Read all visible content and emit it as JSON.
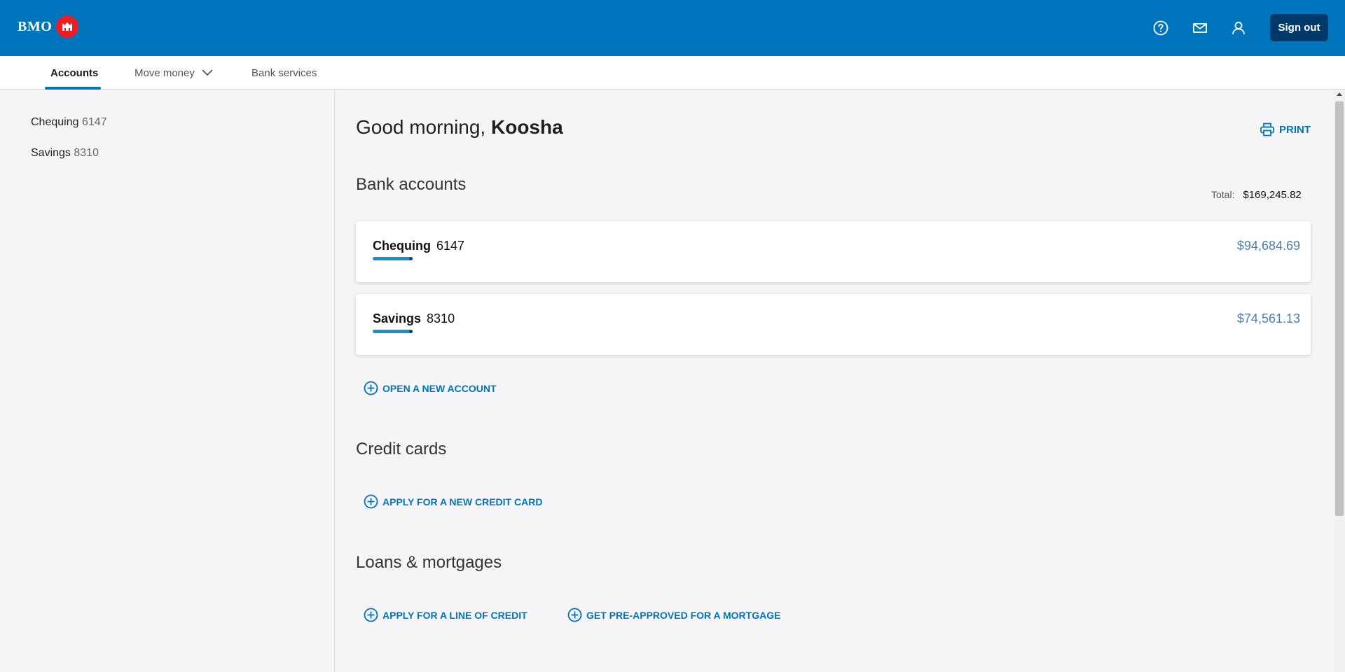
{
  "header": {
    "logo_text": "BMO",
    "signout_label": "Sign out",
    "icons": [
      "help-icon",
      "mail-icon",
      "profile-icon"
    ]
  },
  "nav": {
    "tabs": [
      {
        "label": "Accounts",
        "active": true
      },
      {
        "label": "Move money",
        "has_dropdown": true
      },
      {
        "label": "Bank services"
      }
    ]
  },
  "sidebar": {
    "items": [
      {
        "name": "Chequing",
        "number": "6147"
      },
      {
        "name": "Savings",
        "number": "8310"
      }
    ]
  },
  "main": {
    "greeting_prefix": "Good morning,",
    "user_name": "Koosha",
    "print_label": "PRINT",
    "bank_accounts": {
      "title": "Bank accounts",
      "total_label": "Total:",
      "total_value": "$169,245.82",
      "accounts": [
        {
          "name": "Chequing",
          "number": "6147",
          "balance": "$94,684.69"
        },
        {
          "name": "Savings",
          "number": "8310",
          "balance": "$74,561.13"
        }
      ],
      "open_account_label": "OPEN A NEW ACCOUNT"
    },
    "credit_cards": {
      "title": "Credit cards",
      "apply_label": "APPLY FOR A NEW CREDIT CARD"
    },
    "loans": {
      "title": "Loans & mortgages",
      "line_of_credit_label": "APPLY FOR A LINE OF CREDIT",
      "mortgage_label": "GET PRE-APPROVED FOR A MORTGAGE"
    }
  },
  "colors": {
    "brand_blue": "#0075be",
    "brand_red": "#ed1c24",
    "signout_bg": "#003a6a",
    "amount_color": "#4a7fb0"
  }
}
